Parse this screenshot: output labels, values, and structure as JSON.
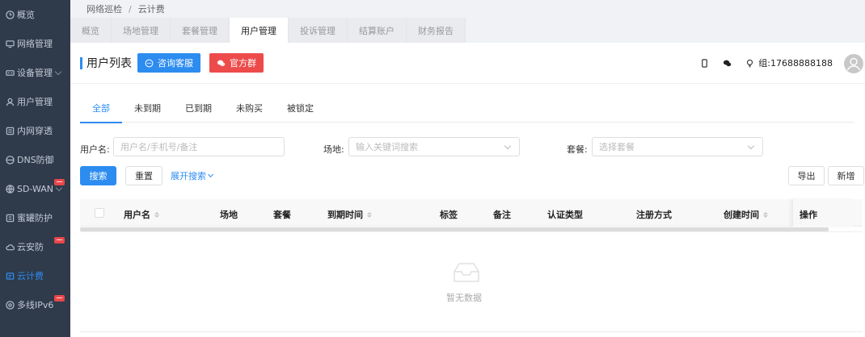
{
  "sidebar": {
    "items": [
      {
        "label": "概览",
        "icon": "clock-icon"
      },
      {
        "label": "网络管理",
        "icon": "monitor-icon"
      },
      {
        "label": "设备管理",
        "icon": "device-icon",
        "chevron": true
      },
      {
        "label": "用户管理",
        "icon": "user-icon"
      },
      {
        "label": "内网穿透",
        "icon": "list-icon"
      },
      {
        "label": "DNS防御",
        "icon": "shield-icon"
      },
      {
        "label": "SD-WAN",
        "icon": "globe-icon",
        "chevron": true,
        "hot": true
      },
      {
        "label": "蜜罐防护",
        "icon": "honeypot-icon"
      },
      {
        "label": "云安防",
        "icon": "cloud-icon",
        "hot": true
      },
      {
        "label": "云计费",
        "icon": "billing-icon",
        "active": true
      },
      {
        "label": "多线IPv6",
        "icon": "ipv6-icon",
        "hot": true
      }
    ]
  },
  "breadcrumb": {
    "parent": "网络巡检",
    "separator": "/",
    "current": "云计费"
  },
  "module_tabs": [
    {
      "label": "概览"
    },
    {
      "label": "场地管理"
    },
    {
      "label": "套餐管理"
    },
    {
      "label": "用户管理",
      "active": true
    },
    {
      "label": "投诉管理"
    },
    {
      "label": "结算账户"
    },
    {
      "label": "财务报告"
    }
  ],
  "header": {
    "title": "用户列表",
    "consult_label": "咨询客服",
    "group_label": "官方群",
    "org_text": "组:17688888188"
  },
  "status_tabs": [
    {
      "label": "全部",
      "active": true
    },
    {
      "label": "未到期"
    },
    {
      "label": "已到期"
    },
    {
      "label": "未购买"
    },
    {
      "label": "被锁定"
    }
  ],
  "search": {
    "username_label": "用户名:",
    "username_placeholder": "用户名/手机号/备注",
    "venue_label": "场地:",
    "venue_placeholder": "输入关键词搜索",
    "package_label": "套餐:",
    "package_placeholder": "选择套餐",
    "search_button": "搜索",
    "reset_button": "重置",
    "expand_link": "展开搜索"
  },
  "actions": {
    "export_label": "导出",
    "add_label": "新增"
  },
  "table": {
    "columns": [
      "用户名",
      "场地",
      "套餐",
      "到期时间",
      "标签",
      "备注",
      "认证类型",
      "注册方式",
      "创建时间",
      "操作"
    ],
    "empty_text": "暂无数据"
  },
  "colors": {
    "primary": "#2d8cf0",
    "danger": "#ed4b4b",
    "sidebar_bg": "#2f3a4a"
  }
}
